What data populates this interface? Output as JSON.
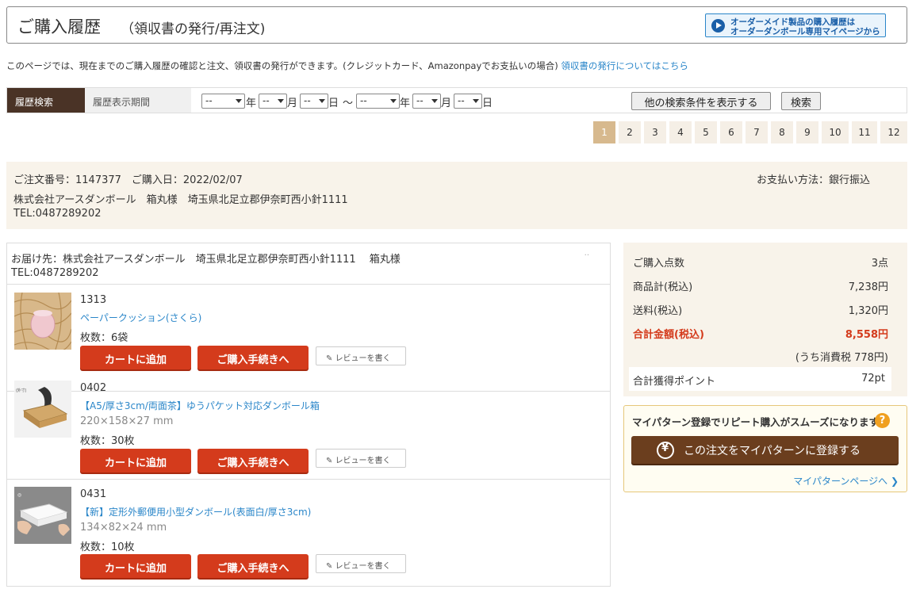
{
  "header": {
    "title": "ご購入履歴",
    "subtitle": "（領収書の発行/再注文)",
    "order_made_line1": "オーダーメイド製品の購入履歴は",
    "order_made_line2": "オーダーダンボール専用マイページから"
  },
  "description": {
    "text": "このページでは、現在までのご購入履歴の確認と注文、領収書の発行ができます。(クレジットカード、Amazonpayでお支払いの場合)",
    "link": "領収書の発行についてはこちら"
  },
  "search": {
    "label": "履歴検索",
    "period_label": "履歴表示期間",
    "from_year": "--",
    "from_month": "--",
    "from_day": "--",
    "to_year": "--",
    "to_month": "--",
    "to_day": "--",
    "year_unit": "年",
    "month_unit": "月",
    "day_unit": "日",
    "range_sep": "～",
    "more_button": "他の検索条件を表示する",
    "search_button": "検索"
  },
  "pagination": {
    "pages": [
      "1",
      "2",
      "3",
      "4",
      "5",
      "6",
      "7",
      "8",
      "9",
      "10",
      "11",
      "12"
    ],
    "current": "1"
  },
  "order": {
    "line1": "ご注文番号：1147377　ご購入日：2022/02/07",
    "line2": "株式会社アースダンボール　箱丸様　埼玉県北足立郡伊奈町西小針1111",
    "line3": "TEL:0487289202",
    "payment": "お支払い方法：銀行振込"
  },
  "delivery": {
    "address": "お届け先：株式会社アースダンボール　埼玉県北足立郡伊奈町西小針1111　 箱丸様",
    "tel": "TEL:0487289202",
    "dots": "··"
  },
  "items": [
    {
      "code": "1313",
      "name": "ペーパークッション(さくら)",
      "size": "",
      "qty": "枚数：6袋",
      "thumb_icon": "paper-cushion-image"
    },
    {
      "code": "0402",
      "name": "【A5/厚さ3cm/両面茶】ゆうパケット対応ダンボール箱",
      "size": "220×158×27 mm",
      "qty": "枚数：30枚",
      "thumb_icon": "brown-box-image"
    },
    {
      "code": "0431",
      "name": "【新】定形外郵便用小型ダンボール(表面白/厚さ3cm)",
      "size": "134×82×24 mm",
      "qty": "枚数：10枚",
      "thumb_icon": "white-box-image"
    }
  ],
  "item_buttons": {
    "add_to_cart": "カートに追加",
    "checkout": "ご購入手続きへ",
    "review": "レビューを書く"
  },
  "summary": {
    "count_label": "ご購入点数",
    "count_value": "3点",
    "subtotal_label": "商品計(税込)",
    "subtotal_value": "7,238円",
    "shipping_label": "送料(税込)",
    "shipping_value": "1,320円",
    "total_label": "合計金額(税込)",
    "total_value": "8,558円",
    "tax_note": "(うち消費税 778円)",
    "points_label": "合計獲得ポイント",
    "points_value": "72pt"
  },
  "mypattern": {
    "headline": "マイパターン登録でリピート購入がスムーズになります",
    "help": "?",
    "button": "この注文をマイパターンに登録する",
    "link": "マイパターンページへ ❯"
  },
  "colors": {
    "accent_red": "#d43b1c",
    "brown": "#6b3e1e",
    "link_blue": "#2a86c9",
    "beige": "#f8f3ea"
  }
}
